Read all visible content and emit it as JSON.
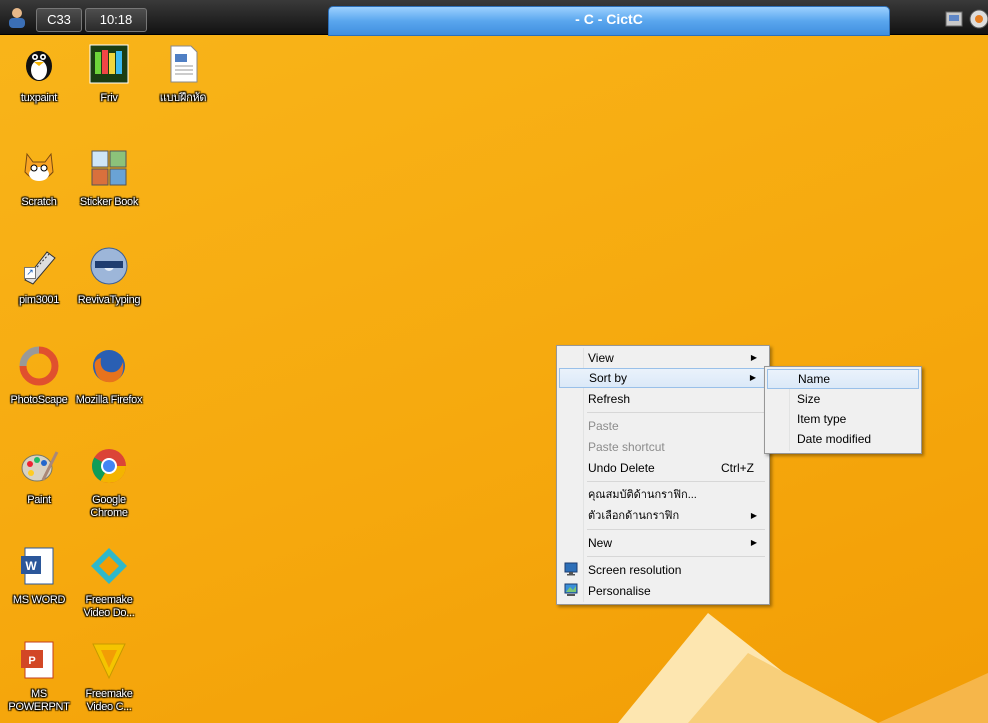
{
  "topbar": {
    "station": "C33",
    "clock": "10:18",
    "title": "- C - CictC"
  },
  "desktop_icons": [
    {
      "label": "tuxpaint"
    },
    {
      "label": "Friv"
    },
    {
      "label": "แบบฝึกหัด"
    },
    {
      "label": "Scratch"
    },
    {
      "label": "Sticker Book"
    },
    {
      "label": "pim3001"
    },
    {
      "label": "RevivaTyping"
    },
    {
      "label": "PhotoScape"
    },
    {
      "label": "Mozilla Firefox"
    },
    {
      "label": "Paint"
    },
    {
      "label": "Google Chrome"
    },
    {
      "label": "MS WORD"
    },
    {
      "label": "Freemake Video Do..."
    },
    {
      "label": "MS POWERPNT"
    },
    {
      "label": "Freemake Video C..."
    }
  ],
  "context_menu": {
    "view": "View",
    "sort_by": "Sort by",
    "refresh": "Refresh",
    "paste": "Paste",
    "paste_shortcut": "Paste shortcut",
    "undo_delete": "Undo Delete",
    "undo_shortcut": "Ctrl+Z",
    "graphics_properties": "คุณสมบัติด้านกราฟิก...",
    "graphics_options": "ตัวเลือกด้านกราฟิก",
    "new": "New",
    "screen_resolution": "Screen resolution",
    "personalise": "Personalise"
  },
  "sort_submenu": {
    "name": "Name",
    "size": "Size",
    "item_type": "Item type",
    "date_modified": "Date modified"
  },
  "colors": {
    "desktop": "#f6a90e",
    "title_tab": "#5aa6ee",
    "menu_bg": "#f0f0f0",
    "highlight": "#dbe9f8"
  }
}
